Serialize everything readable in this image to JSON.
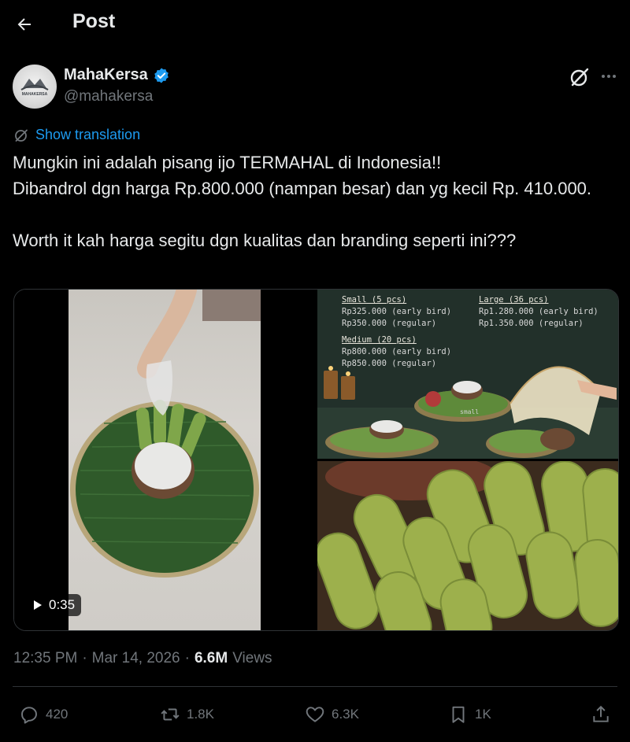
{
  "header": {
    "title": "Post"
  },
  "author": {
    "name": "MahaKersa",
    "handle": "@mahakersa",
    "avatar_text": "MAHAKERSA"
  },
  "translation_link": "Show translation",
  "post_text": "Mungkin ini adalah pisang ijo TERMAHAL di Indonesia!!\nDibandrol dgn harga Rp.800.000 (nampan besar) dan yg kecil Rp. 410.000.\n\nWorth it kah harga segitu dgn kualitas dan branding seperti ini???",
  "video": {
    "duration": "0:35"
  },
  "price_image": {
    "small_title": "Small (5 pcs)",
    "small_early": "Rp325.000 (early bird)",
    "small_regular": "Rp350.000 (regular)",
    "medium_title": "Medium (20 pcs)",
    "medium_early": "Rp800.000 (early bird)",
    "medium_regular": "Rp850.000 (regular)",
    "large_title": "Large (36 pcs)",
    "large_early": "Rp1.280.000 (early bird)",
    "large_regular": "Rp1.350.000 (regular)",
    "small_label": "small"
  },
  "meta": {
    "time": "12:35 PM",
    "separator": "·",
    "date": "Mar 14, 2026",
    "views_count": "6.6M",
    "views_label": "Views"
  },
  "actions": {
    "replies": "420",
    "reposts": "1.8K",
    "likes": "6.3K",
    "bookmarks": "1K"
  },
  "colors": {
    "background": "#000000",
    "text": "#e7e9ea",
    "muted": "#71767b",
    "accent": "#1d9bf0",
    "border": "#2f3336"
  }
}
